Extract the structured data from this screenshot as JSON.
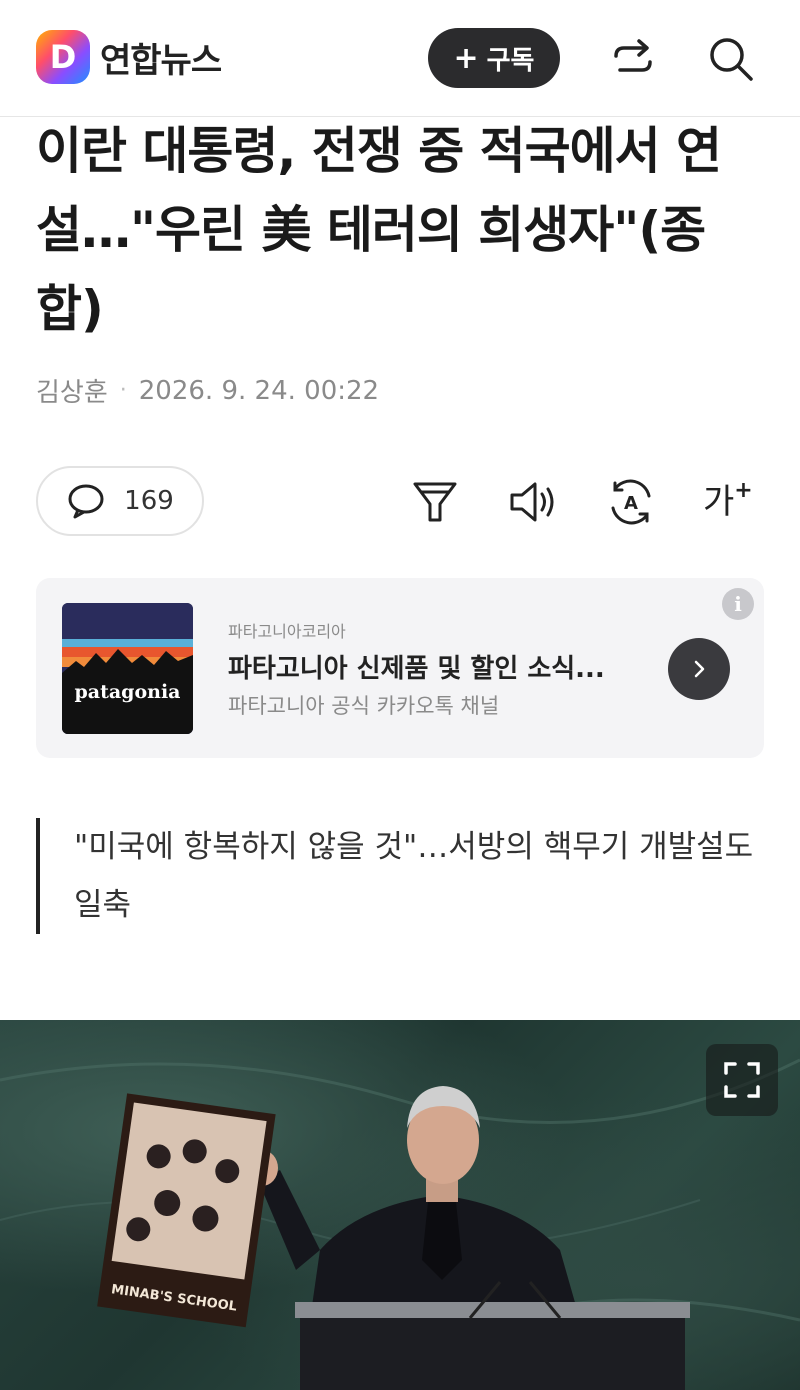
{
  "header": {
    "logo_letter": "D",
    "brand": "연합뉴스",
    "subscribe_label": "구독"
  },
  "article": {
    "title": "이란 대통령, 전쟁 중 적국에서 연설…\"우린 美 테러의 희생자\"(종합)",
    "author": "김상훈",
    "datetime": "2026. 9. 24. 00:22",
    "comment_count": "169",
    "font_size_label": "가",
    "summary": "\"미국에 항복하지 않을 것\"…서방의 핵무기 개발설도 일축"
  },
  "ad": {
    "brand_logo_text": "patagonia",
    "source": "파타고니아코리아",
    "headline": "파타고니아 신제품 및 할인 소식...",
    "description": "파타고니아 공식 카카오톡 채널",
    "info_label": "i"
  },
  "photo": {
    "sign_text": "MINAB'S SCHOOL"
  }
}
